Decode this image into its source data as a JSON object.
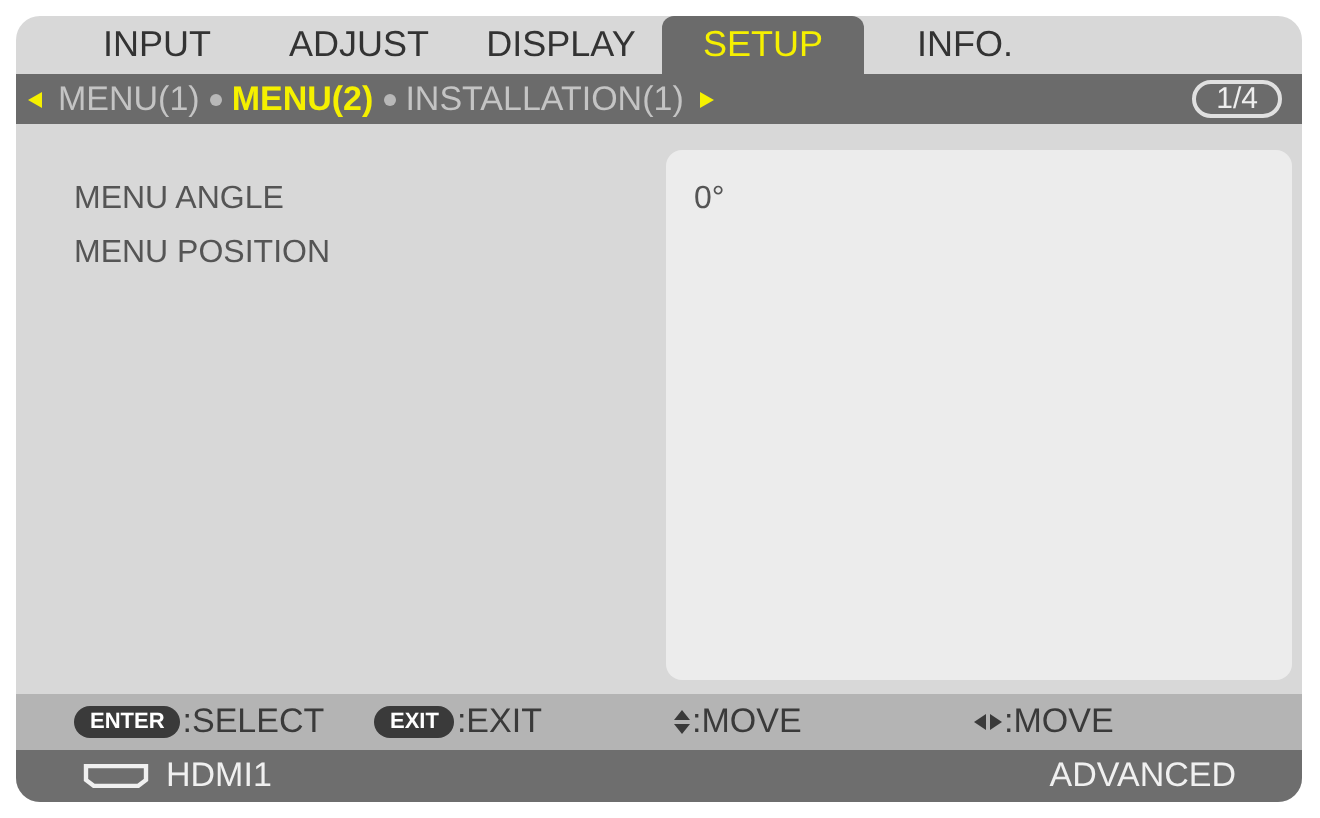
{
  "tabs": [
    {
      "label": "INPUT",
      "selected": false
    },
    {
      "label": "ADJUST",
      "selected": false
    },
    {
      "label": "DISPLAY",
      "selected": false
    },
    {
      "label": "SETUP",
      "selected": true
    },
    {
      "label": "INFO.",
      "selected": false
    }
  ],
  "subtabs": [
    {
      "label": "MENU(1)",
      "selected": false
    },
    {
      "label": "MENU(2)",
      "selected": true
    },
    {
      "label": "INSTALLATION(1)",
      "selected": false
    }
  ],
  "page_counter": "1/4",
  "settings": [
    {
      "label": "MENU ANGLE",
      "value": "0°"
    },
    {
      "label": "MENU POSITION"
    }
  ],
  "hints": [
    {
      "kind": "key",
      "key": "ENTER",
      "action": ":SELECT"
    },
    {
      "kind": "key",
      "key": "EXIT",
      "action": ":EXIT"
    },
    {
      "kind": "updown",
      "action": ":MOVE"
    },
    {
      "kind": "leftright",
      "action": ":MOVE"
    }
  ],
  "status_bar": {
    "source": "HDMI1",
    "mode": "ADVANCED"
  }
}
